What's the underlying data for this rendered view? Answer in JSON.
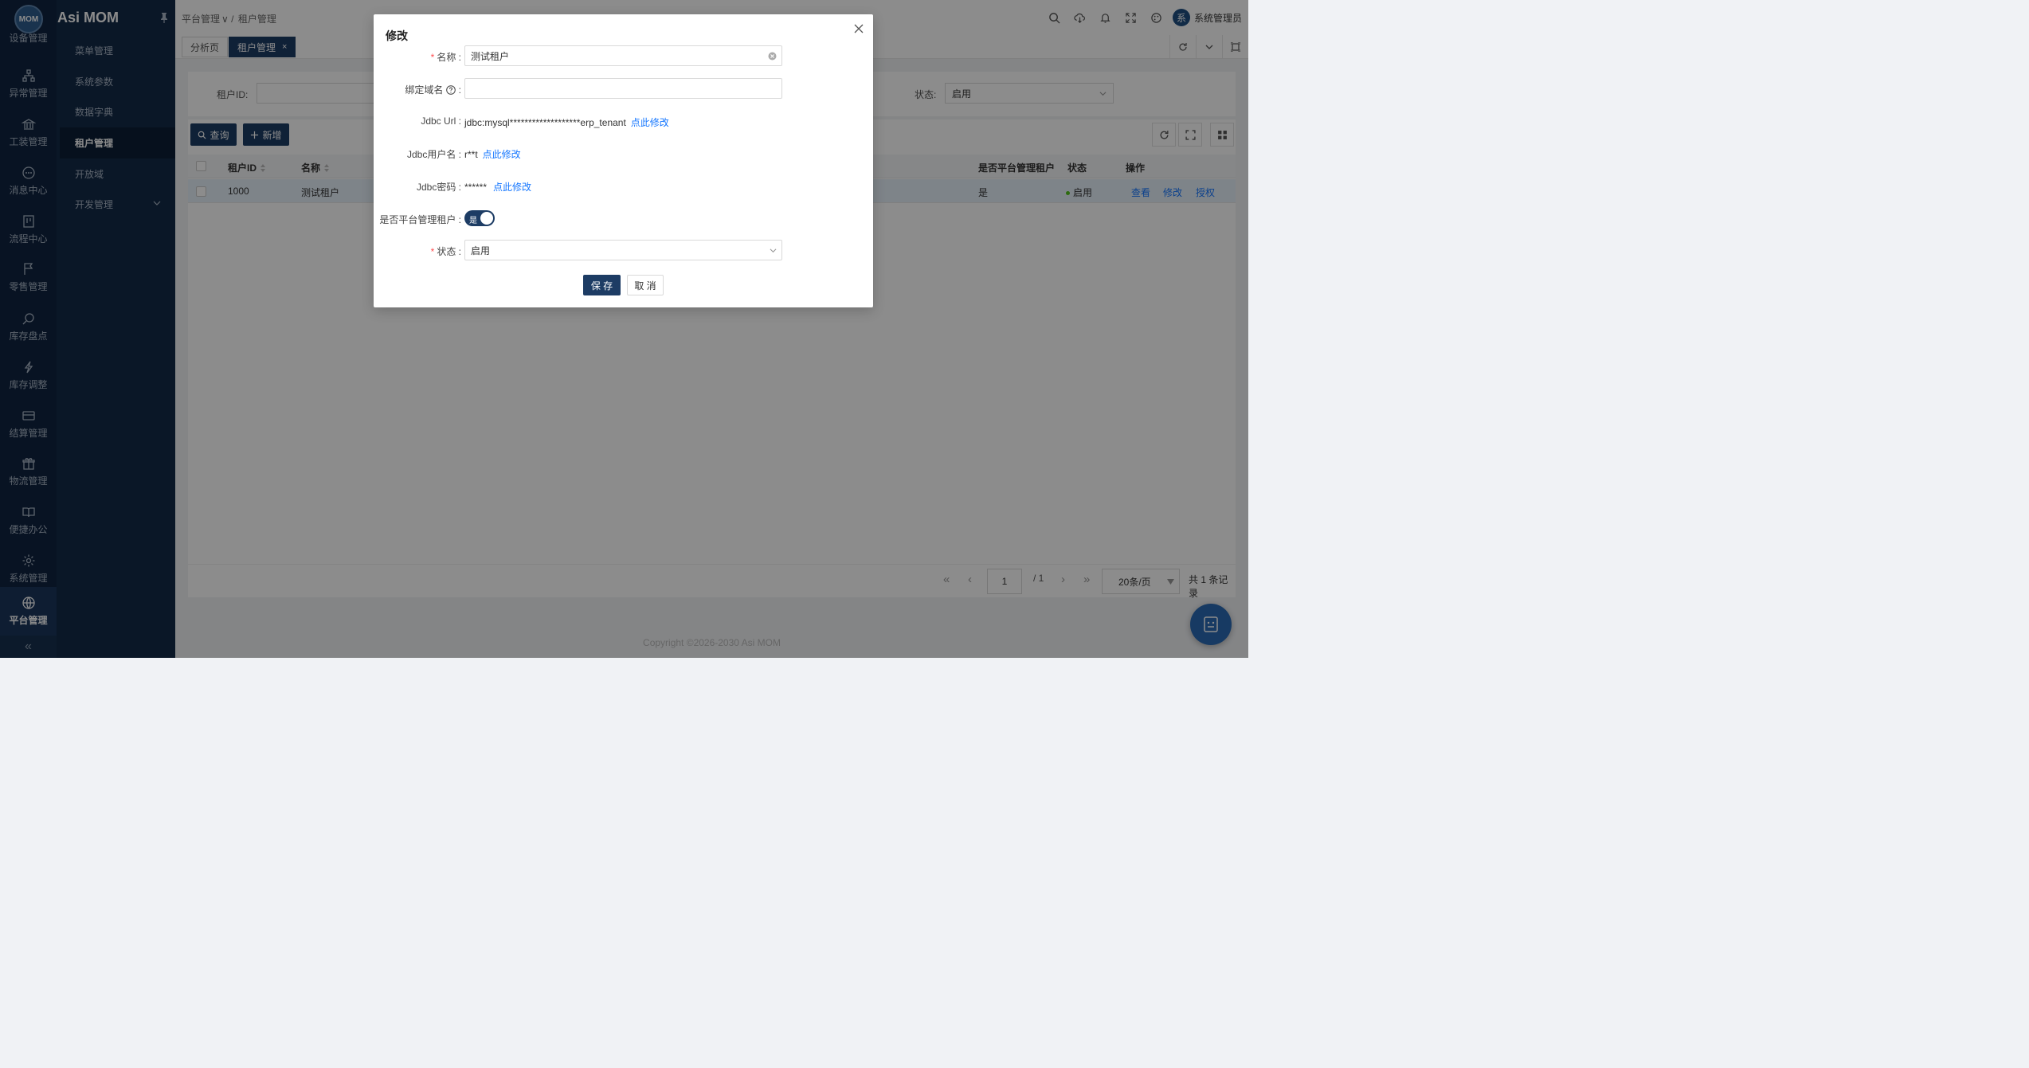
{
  "brand": {
    "logo_text": "MOM",
    "title": "Asi MOM"
  },
  "rail": {
    "items": [
      {
        "label": "设备管理",
        "icon": "device-icon"
      },
      {
        "label": "异常管理",
        "icon": "sitemap-icon"
      },
      {
        "label": "工装管理",
        "icon": "bank-icon"
      },
      {
        "label": "消息中心",
        "icon": "message-icon"
      },
      {
        "label": "流程中心",
        "icon": "flow-icon"
      },
      {
        "label": "零售管理",
        "icon": "flag-icon"
      },
      {
        "label": "库存盘点",
        "icon": "search-icon"
      },
      {
        "label": "库存调整",
        "icon": "thunder-icon"
      },
      {
        "label": "结算管理",
        "icon": "card-icon"
      },
      {
        "label": "物流管理",
        "icon": "gift-icon"
      },
      {
        "label": "便捷办公",
        "icon": "book-icon"
      },
      {
        "label": "系统管理",
        "icon": "gear-icon"
      },
      {
        "label": "平台管理",
        "icon": "globe-icon"
      }
    ],
    "collapse": "«"
  },
  "submenu": {
    "items": [
      {
        "label": "菜单管理"
      },
      {
        "label": "系统参数"
      },
      {
        "label": "数据字典"
      },
      {
        "label": "租户管理"
      },
      {
        "label": "开放域"
      },
      {
        "label": "开发管理"
      }
    ]
  },
  "header": {
    "breadcrumb": [
      "平台管理",
      "租户管理"
    ],
    "user": {
      "avatar_char": "系",
      "name": "系统管理员"
    }
  },
  "tabs": [
    {
      "label": "分析页"
    },
    {
      "label": "租户管理",
      "close": "×"
    }
  ],
  "search": {
    "tenant_id_label": "租户ID:",
    "tenant_id_value": "",
    "status_label": "状态:",
    "status_value": "启用"
  },
  "toolbar": {
    "query_label": "查询",
    "add_label": "新增"
  },
  "table": {
    "columns": [
      "租户ID",
      "名称",
      "是否平台管理租户",
      "状态",
      "操作"
    ],
    "rows": [
      {
        "id": "1000",
        "name": "测试租户",
        "is_platform": "是",
        "status": "启用",
        "actions": [
          "查看",
          "修改",
          "授权"
        ]
      }
    ]
  },
  "pagination": {
    "first": "«",
    "prev": "‹",
    "page": "1",
    "total_pages": "/ 1",
    "next": "›",
    "last": "»",
    "page_size": "20条/页",
    "total": "共 1 条记录"
  },
  "copyright": "Copyright ©2026-2030 Asi MOM",
  "modal": {
    "title": "修改",
    "close": "×",
    "name_label": "名称",
    "name_value": "测试租户",
    "domain_label": "绑定域名",
    "domain_value": "",
    "jdbc_url_label": "Jdbc Url",
    "jdbc_url_value": "jdbc:mysql*******************erp_tenant",
    "jdbc_url_action": "点此修改",
    "jdbc_user_label": "Jdbc用户名",
    "jdbc_user_value": "r**t",
    "jdbc_user_action": "点此修改",
    "jdbc_pwd_label": "Jdbc密码",
    "jdbc_pwd_value": "******",
    "jdbc_pwd_action": "点此修改",
    "platform_label": "是否平台管理租户",
    "platform_value": "是",
    "status_label": "状态",
    "status_value": "启用",
    "save_label": "保 存",
    "cancel_label": "取 消"
  },
  "colors": {
    "primary": "#1d3c64",
    "rail_bg": "#0f2440",
    "link": "#1677ff",
    "required": "#ff4d4f",
    "status_ok": "#52c41a"
  }
}
